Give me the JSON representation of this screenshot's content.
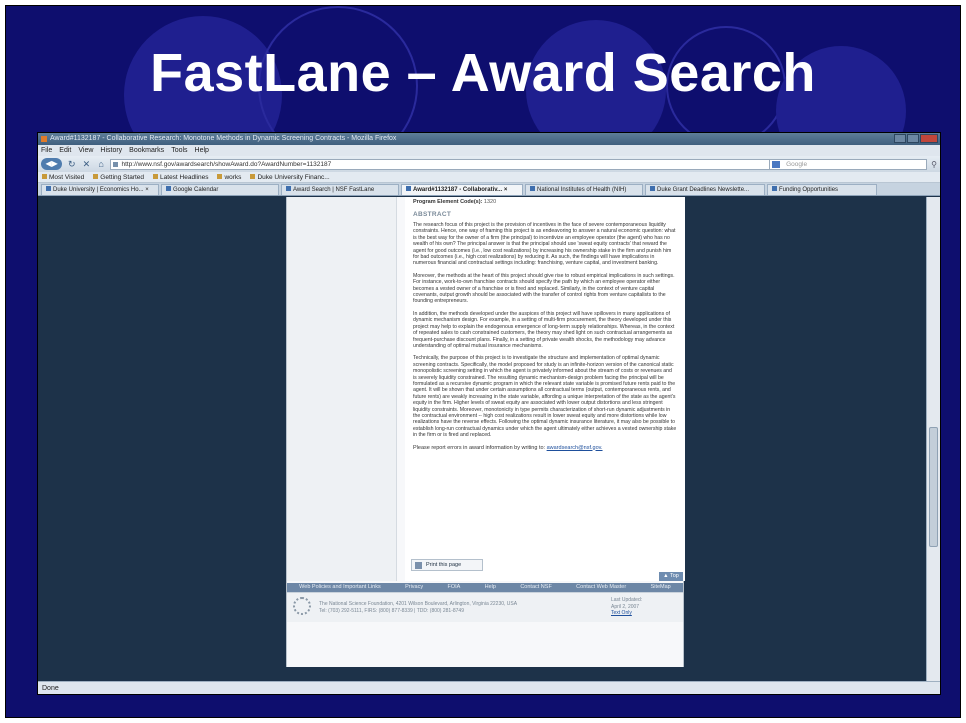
{
  "slide": {
    "title": "FastLane – Award Search",
    "colors": {
      "background": "#0e0e6e",
      "circle": "#1f1f8f",
      "title": "#ffffff"
    }
  },
  "browser": {
    "window_title": "Award#1132187 - Collaborative Research: Monotone Methods in Dynamic Screening Contracts - Mozilla Firefox",
    "menu": [
      "File",
      "Edit",
      "View",
      "History",
      "Bookmarks",
      "Tools",
      "Help"
    ],
    "url": "http://www.nsf.gov/awardsearch/showAward.do?AwardNumber=1132187",
    "search_placeholder": "Google",
    "bookmarks": [
      "Most Visited",
      "Getting Started",
      "Latest Headlines",
      "works",
      "Duke University Financ..."
    ],
    "tabs": [
      {
        "label": "Duke University | Economics Ho... ×"
      },
      {
        "label": "Google Calendar"
      },
      {
        "label": "Award Search | NSF FastLane"
      },
      {
        "label": "Award#1132187 - Collaborativ... ×"
      },
      {
        "label": "National Institutes of Health (NIH)"
      },
      {
        "label": "Duke Grant Deadlines Newslette..."
      },
      {
        "label": "Funding Opportunities"
      }
    ],
    "status": "Done"
  },
  "page": {
    "program_element_label": "Program Element Code(s):",
    "program_element_value": "1320",
    "abstract_heading": "ABSTRACT",
    "paragraphs": [
      "The research focus of this project is the provision of incentives in the face of severe contemporaneous liquidity constraints. Hence, one way of framing this project is as endeavoring to answer a natural economic question: what is the best way for the owner of a firm (the principal) to incentivize an employee operator (the agent) who has no wealth of his own? The principal answer is that the principal should use 'sweat equity contracts' that reward the agent for good outcomes (i.e., low cost realizations) by increasing his ownership stake in the firm and punish him for bad outcomes (i.e., high cost realizations) by reducing it. As such, the findings will have implications in numerous financial and contractual settings including: franchising, venture capital, and investment banking.",
      "Moreover, the methods at the heart of this project should give rise to robust empirical implications in such settings. For instance, work-to-own franchise contracts should specify the path by which an employee operator either becomes a vested owner of a franchise or is fired and replaced. Similarly, in the context of venture capital covenants, output growth should be associated with the transfer of control rights from venture capitalists to the founding entrepreneurs.",
      "In addition, the methods developed under the auspices of this project will have spillovers in many applications of dynamic mechanism design. For example, in a setting of multi-firm procurement, the theory developed under this project may help to explain the endogenous emergence of long-term supply relationships. Whereas, in the context of repeated sales to cash constrained customers, the theory may shed light on such contractual arrangements as frequent-purchase discount plans. Finally, in a setting of private wealth shocks, the methodology may advance understanding of optimal mutual insurance mechanisms.",
      "Technically, the purpose of this project is to investigate the structure and implementation of optimal dynamic screening contracts. Specifically, the model proposed for study is an infinite-horizon version of the canonical static monopolistic screening setting in which the agent is privately informed about the stream of costs or revenues and is severely liquidity constrained. The resulting dynamic mechanism-design problem facing the principal will be formulated as a recursive dynamic program in which the relevant state variable is promised future rents paid to the agent. It will be shown that under certain assumptions all contractual terms (output, contemporaneous rents, and future rents) are weakly increasing in the state variable, affording a unique interpretation of the state as the agent's equity in the firm. Higher levels of sweat equity are associated with lower output distortions and less stringent liquidity constraints. Moreover, monotonicity in type permits characterization of short-run dynamic adjustments in the contractual environment -- high cost realizations result in lower sweat equity and more distortions while low realizations have the reverse effects. Following the optimal dynamic insurance literature, it may also be possible to establish long-run contractual dynamics under which the agent ultimately either achieves a vested ownership stake in the firm or is fired and replaced."
    ],
    "report_text": "Please report errors in award information by writing to:",
    "report_email": "awardsearch@nsf.gov.",
    "print_label": "Print this page",
    "top_label": "▲ Top",
    "footer_links": [
      "Web Policies and Important Links",
      "Privacy",
      "FOIA",
      "Help",
      "Contact NSF",
      "Contact Web Master",
      "SiteMap"
    ],
    "footer_address": "The National Science Foundation, 4201 Wilson Boulevard, Arlington, Virginia 22230, USA",
    "footer_phones": "Tel: (703) 292-5111, FIRS: (800) 877-8339 | TDD: (800) 281-8749",
    "footer_updated_label": "Last Updated:",
    "footer_updated_date": "April 2, 2007",
    "footer_text_only": "Text Only"
  }
}
